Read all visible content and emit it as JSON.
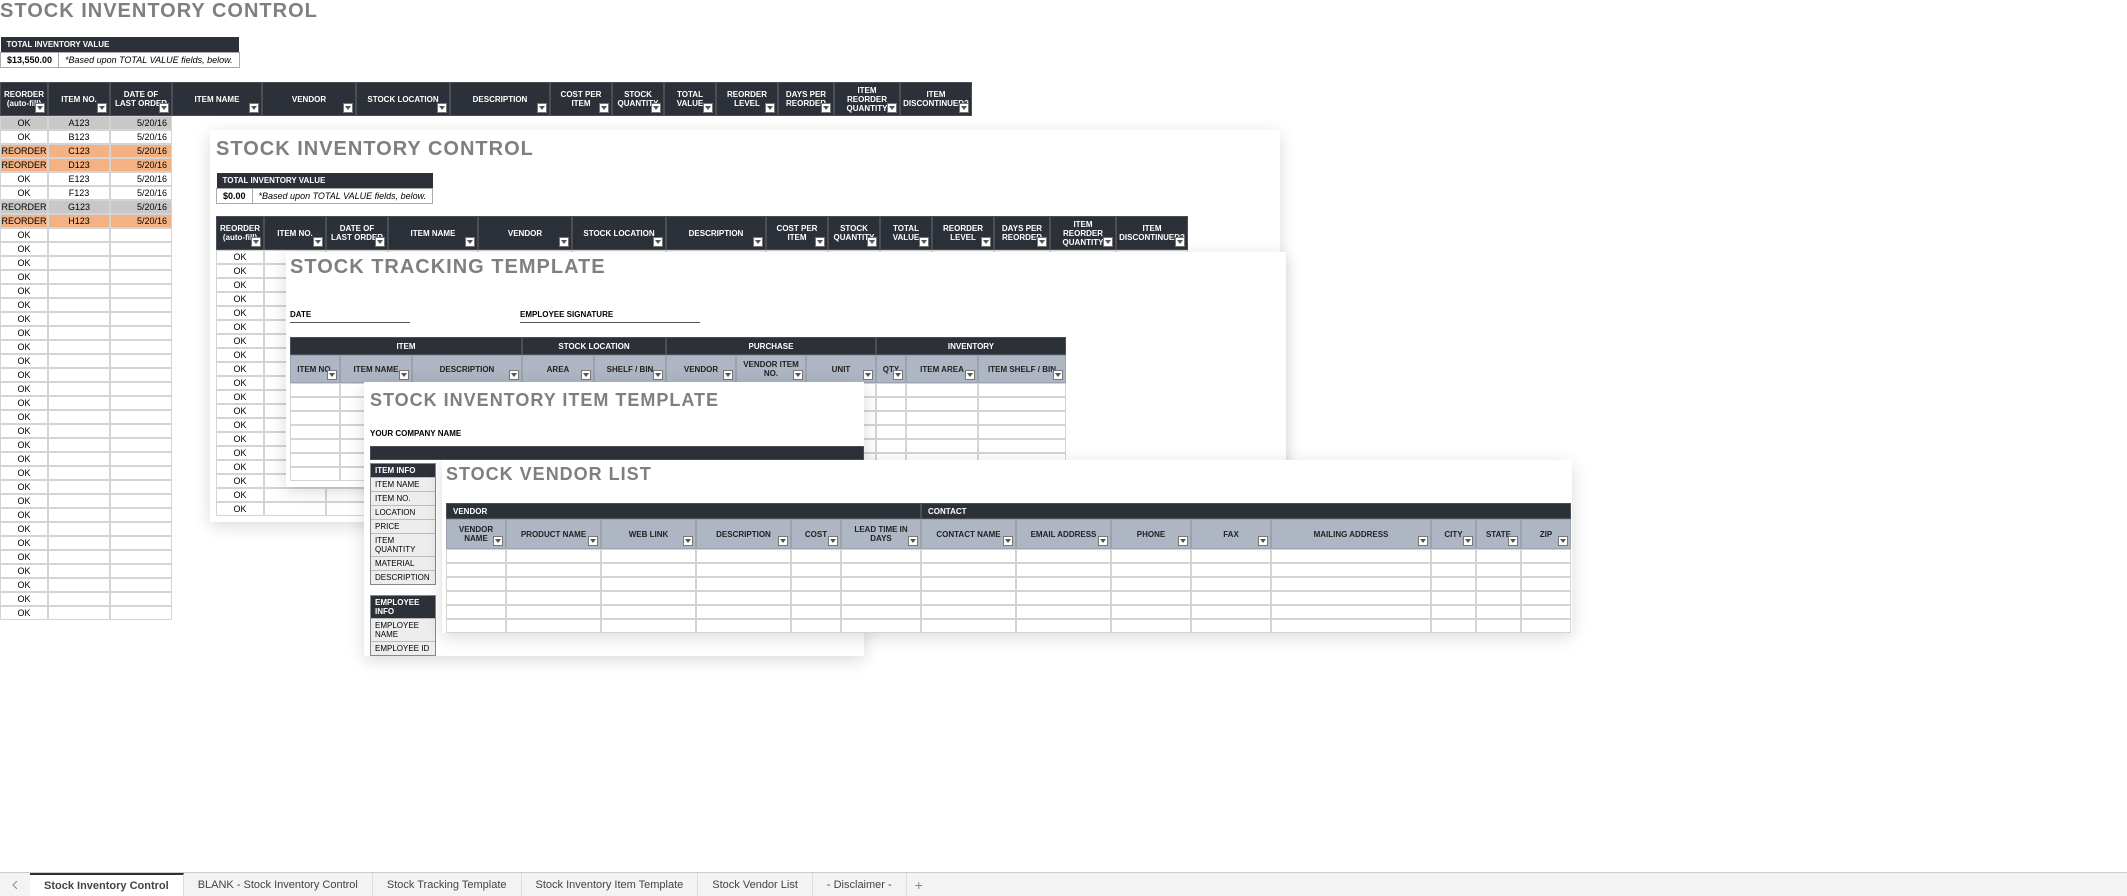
{
  "sheet1": {
    "title": "STOCK INVENTORY CONTROL",
    "total_label": "TOTAL INVENTORY VALUE",
    "total_value": "$13,550.00",
    "total_note": "*Based upon TOTAL VALUE fields, below.",
    "headers": [
      "REORDER (auto-fill)",
      "ITEM NO.",
      "DATE OF LAST ORDER",
      "ITEM NAME",
      "VENDOR",
      "STOCK LOCATION",
      "DESCRIPTION",
      "COST PER ITEM",
      "STOCK QUANTITY",
      "TOTAL VALUE",
      "REORDER LEVEL",
      "DAYS PER REORDER",
      "ITEM REORDER QUANTITY",
      "ITEM DISCONTINUED?"
    ],
    "rows": [
      {
        "r": "OK",
        "i": "A123",
        "d": "5/20/16",
        "hl": "grey"
      },
      {
        "r": "OK",
        "i": "B123",
        "d": "5/20/16",
        "hl": ""
      },
      {
        "r": "REORDER",
        "i": "C123",
        "d": "5/20/16",
        "hl": "orange"
      },
      {
        "r": "REORDER",
        "i": "D123",
        "d": "5/20/16",
        "hl": "orange"
      },
      {
        "r": "OK",
        "i": "E123",
        "d": "5/20/16",
        "hl": ""
      },
      {
        "r": "OK",
        "i": "F123",
        "d": "5/20/16",
        "hl": ""
      },
      {
        "r": "REORDER",
        "i": "G123",
        "d": "5/20/16",
        "hl": "grey"
      },
      {
        "r": "REORDER",
        "i": "H123",
        "d": "5/20/16",
        "hl": "orange"
      }
    ],
    "ok_label": "OK"
  },
  "sheet2": {
    "title": "STOCK INVENTORY CONTROL",
    "total_label": "TOTAL INVENTORY VALUE",
    "total_value": "$0.00",
    "total_note": "*Based upon TOTAL VALUE fields, below.",
    "headers": [
      "REORDER (auto-fill)",
      "ITEM NO.",
      "DATE OF LAST ORDER",
      "ITEM NAME",
      "VENDOR",
      "STOCK LOCATION",
      "DESCRIPTION",
      "COST PER ITEM",
      "STOCK QUANTITY",
      "TOTAL VALUE",
      "REORDER LEVEL",
      "DAYS PER REORDER",
      "ITEM REORDER QUANTITY",
      "ITEM DISCONTINUED?"
    ]
  },
  "sheet3": {
    "title": "STOCK TRACKING TEMPLATE",
    "date_label": "DATE",
    "sig_label": "EMPLOYEE SIGNATURE",
    "group_headers": [
      "ITEM",
      "STOCK LOCATION",
      "PURCHASE",
      "INVENTORY"
    ],
    "sub_headers": [
      "ITEM NO.",
      "ITEM NAME",
      "DESCRIPTION",
      "AREA",
      "SHELF / BIN",
      "VENDOR",
      "VENDOR ITEM NO.",
      "UNIT",
      "QTY",
      "ITEM AREA",
      "ITEM SHELF / BIN"
    ]
  },
  "sheet4": {
    "title": "STOCK INVENTORY ITEM TEMPLATE",
    "company": "YOUR COMPANY NAME",
    "item_info": "ITEM INFO",
    "item_rows": [
      "ITEM NAME",
      "ITEM NO.",
      "LOCATION",
      "PRICE",
      "ITEM QUANTITY",
      "MATERIAL",
      "DESCRIPTION"
    ],
    "emp_info": "EMPLOYEE INFO",
    "emp_rows": [
      "EMPLOYEE NAME",
      "EMPLOYEE ID"
    ]
  },
  "sheet5": {
    "title": "STOCK VENDOR LIST",
    "group_headers": [
      "VENDOR",
      "CONTACT"
    ],
    "sub_headers": [
      "VENDOR NAME",
      "PRODUCT NAME",
      "WEB LINK",
      "DESCRIPTION",
      "COST",
      "LEAD TIME IN DAYS",
      "CONTACT NAME",
      "EMAIL ADDRESS",
      "PHONE",
      "FAX",
      "MAILING ADDRESS",
      "CITY",
      "STATE",
      "ZIP"
    ]
  },
  "tabs": [
    "Stock Inventory Control",
    "BLANK - Stock Inventory Control",
    "Stock Tracking Template",
    "Stock Inventory Item Template",
    "Stock Vendor List",
    "- Disclaimer -"
  ]
}
